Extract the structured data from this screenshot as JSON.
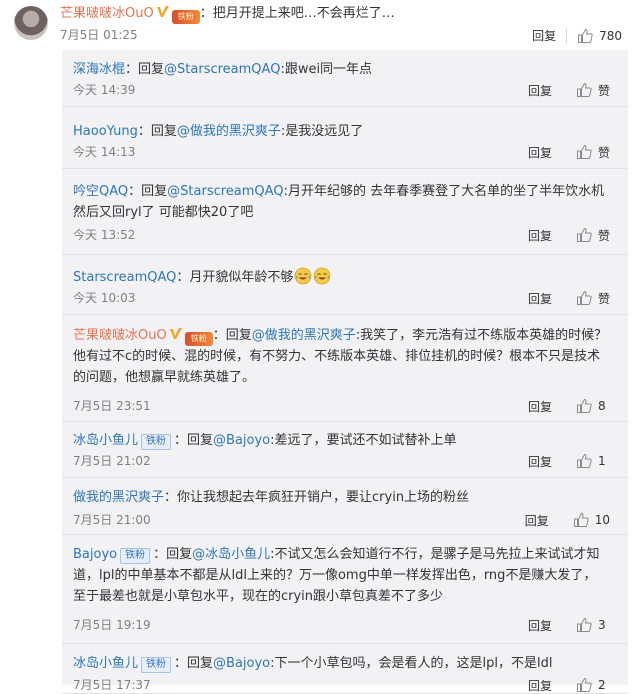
{
  "main": {
    "username": "芒果啵啵冰OuO",
    "medal_text": "铁粉",
    "text": "：把月开提上来吧…不会再烂了…",
    "time": "7月5日 01:25",
    "reply_label": "回复",
    "likes": "780"
  },
  "labels": {
    "reply": "回复",
    "like": "赞",
    "fan_badge": "铁粉"
  },
  "colors": {
    "username": "#eb7350",
    "link": "#2d76b8",
    "panel_bg": "#f2f2f5"
  },
  "replies": [
    {
      "user": "深海冰棍",
      "prefix": "：回复",
      "mention": "@StarscreamQAQ",
      "text": ":跟wei同一年点",
      "time": "今天 14:39",
      "likes": "赞"
    },
    {
      "user": "HaooYung",
      "prefix": "：回复",
      "mention": "@做我的黑沢爽子",
      "text": ":是我没远见了",
      "time": "今天 14:13",
      "likes": "赞"
    },
    {
      "user": "吟空QAQ",
      "prefix": "：回复",
      "mention": "@StarscreamQAQ",
      "text": ":月开年纪够的 去年春季赛登了大名单的坐了半年饮水机然后又回ryl了 可能都快20了吧",
      "time": "今天 13:52",
      "likes": "赞"
    },
    {
      "user": "StarscreamQAQ",
      "prefix": "",
      "mention": "",
      "text": "：月开貌似年龄不够",
      "time": "今天 10:03",
      "likes": "赞"
    },
    {
      "user": "芒果啵啵冰OuO",
      "prefix": "：回复",
      "mention": "@做我的黑沢爽子",
      "text": ":我笑了，李元浩有过不练版本英雄的时候？他有过不c的时候、混的时候，有不努力、不练版本英雄、排位挂机的时候？根本不只是技术的问题，他想赢早就练英雄了。",
      "time": "7月5日 23:51",
      "likes": "8"
    },
    {
      "user": "冰岛小鱼儿",
      "prefix": "：回复",
      "mention": "@Bajoyo",
      "text": ":差远了，要试还不如试替补上单",
      "time": "7月5日 21:02",
      "likes": "1"
    },
    {
      "user": "做我的黑沢爽子",
      "prefix": "",
      "mention": "",
      "text": "：你让我想起去年疯狂开销户，要让cryin上场的粉丝",
      "time": "7月5日 21:00",
      "likes": "10"
    },
    {
      "user": "Bajoyo",
      "prefix": "：回复",
      "mention": "@冰岛小鱼儿",
      "text": ":不试又怎么会知道行不行，是骡子是马先拉上来试试才知道，lpl的中单基本不都是从ldl上来的？万一像omg中单一样发挥出色，rng不是赚大发了，至于最差也就是小草包水平，现在的cryin跟小草包真差不了多少",
      "time": "7月5日 19:19",
      "likes": "3"
    },
    {
      "user": "冰岛小鱼儿",
      "prefix": "：回复",
      "mention": "@Bajoyo",
      "text": ":下一个小草包吗，会是看人的，这是lpl，不是ldl",
      "time": "7月5日 17:37",
      "likes": "2"
    }
  ]
}
